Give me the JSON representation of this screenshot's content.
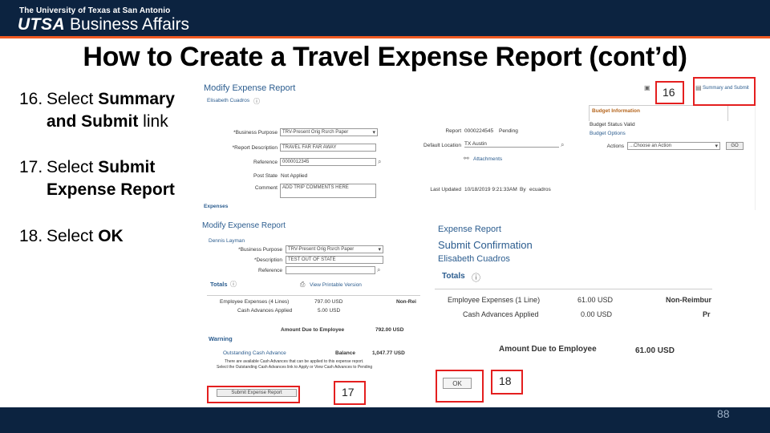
{
  "header": {
    "university": "The University of Texas at San Antonio",
    "brand_bold": "UTSA",
    "brand_rest": "Business Affairs"
  },
  "title": "How to Create a Travel Expense Report (cont’d)",
  "steps": [
    {
      "num": "16.",
      "line1_plain": "Select ",
      "line1_bold": "Summary",
      "line2_bold": "and Submit",
      "line2_plain": " link"
    },
    {
      "num": "17.",
      "line1_plain": "Select ",
      "line1_bold": "Submit",
      "line2_bold": "Expense Report",
      "line2_plain": ""
    },
    {
      "num": "18.",
      "line1_plain": "Select ",
      "line1_bold": "OK",
      "line2_bold": "",
      "line2_plain": ""
    }
  ],
  "panel1": {
    "title": "Modify Expense Report",
    "user": "Elisabeth Cuadros",
    "business_purpose_label": "*Business Purpose",
    "business_purpose_value": "TRV-Present Orig Rsrch Paper",
    "report_description_label": "*Report Description",
    "report_description_value": "TRAVEL FAR FAR AWAY",
    "reference_label": "Reference",
    "reference_value": "0000012345",
    "post_state_label": "Post State",
    "post_state_value": "Not Applied",
    "comment_label": "Comment",
    "comment_value": "ADD TRIP COMMENTS HERE",
    "report_label": "Report",
    "report_value": "0000224545",
    "report_status": "Pending",
    "default_location_label": "Default Location",
    "default_location_value": "TX Austin",
    "attachments": "Attachments",
    "last_updated_label": "Last Updated",
    "last_updated_value": "10/18/2019 9:21:33AM",
    "by_label": "By",
    "by_value": "ecuadros",
    "summary_link": "Summary and Submit",
    "budget_title": "Budget Information",
    "budget_status": "Budget Status  Valid",
    "budget_options": "Budget Options",
    "actions_label": "Actions",
    "actions_value": "...Choose an Action",
    "go": "GO",
    "expenses": "Expenses"
  },
  "panel2": {
    "title": "Modify Expense Report",
    "user": "Dennis Layman",
    "business_purpose_label": "*Business Purpose",
    "business_purpose_value": "TRV-Present Orig Rsrch Paper",
    "description_label": "*Description",
    "description_value": "TEST OUT OF STATE",
    "reference_label": "Reference",
    "totals": "Totals",
    "view_printable": "View Printable Version",
    "employee_expenses_label": "Employee Expenses (4 Lines)",
    "employee_expenses_value": "797.00  USD",
    "cash_advances_label": "Cash Advances Applied",
    "cash_advances_value": "5.00  USD",
    "non_reimb": "Non-Rei",
    "amount_due_label": "Amount Due to Employee",
    "amount_due_value": "792.00  USD",
    "warning": "Warning",
    "outstanding_label": "Outstanding Cash Advance",
    "balance_label": "Balance",
    "balance_value": "1,047.77  USD",
    "warning_text1": "There are available Cash Advances that can be applied to this expense report.",
    "warning_text2": "Select the Outstanding Cash Advances link to Apply or View Cash Advances to Pending",
    "submit_button": "Submit Expense Report"
  },
  "panel3": {
    "line1": "Expense Report",
    "line2": "Submit Confirmation",
    "user": "Elisabeth Cuadros",
    "totals": "Totals",
    "employee_expenses_label": "Employee Expenses (1 Line)",
    "employee_expenses_value": "61.00  USD",
    "non_reimb": "Non-Reimbur",
    "cash_advances_label": "Cash Advances Applied",
    "cash_advances_value": "0.00  USD",
    "pr": "Pr",
    "amount_due_label": "Amount Due to Employee",
    "amount_due_value": "61.00  USD",
    "ok_button": "OK"
  },
  "callouts": {
    "c16": "16",
    "c17": "17",
    "c18": "18"
  },
  "footer": {
    "page_number": "88"
  },
  "colors": {
    "navy": "#0c2340",
    "orange": "#f15a22",
    "callout_red": "#e41f1f",
    "peoplesoft_blue": "#2c5d8f"
  }
}
